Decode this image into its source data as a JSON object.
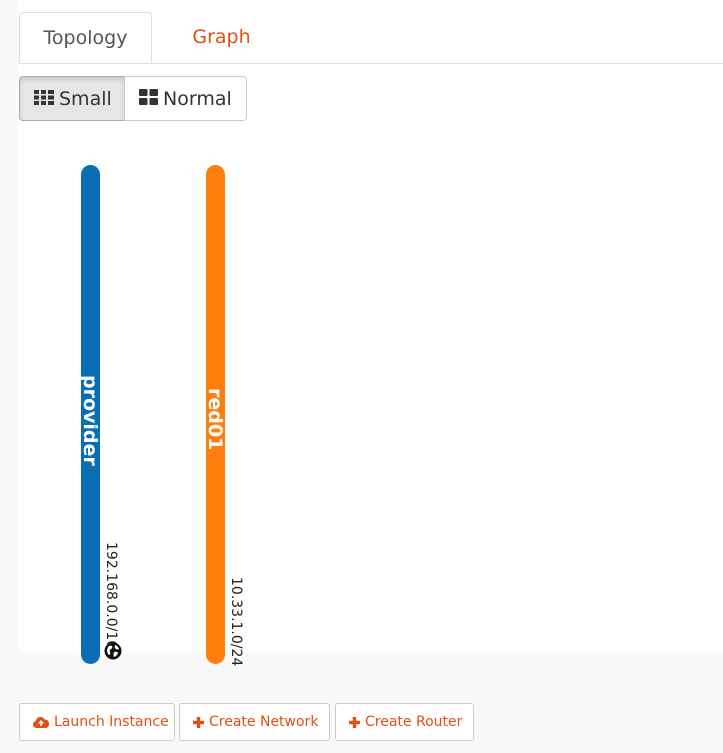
{
  "tabs": {
    "topology": "Topology",
    "graph": "Graph"
  },
  "view_toggle": {
    "small": "Small",
    "normal": "Normal",
    "selected": "Small"
  },
  "networks": [
    {
      "name": "provider",
      "cidr": "192.168.0.0/16",
      "color": "#0a6eb4",
      "external": true
    },
    {
      "name": "red01",
      "cidr": "10.33.1.0/24",
      "color": "#ff7f0e",
      "external": false
    }
  ],
  "actions": {
    "launch_instance": "Launch Instance",
    "create_network": "Create Network",
    "create_router": "Create Router"
  },
  "colors": {
    "accent": "#e24f0f"
  }
}
